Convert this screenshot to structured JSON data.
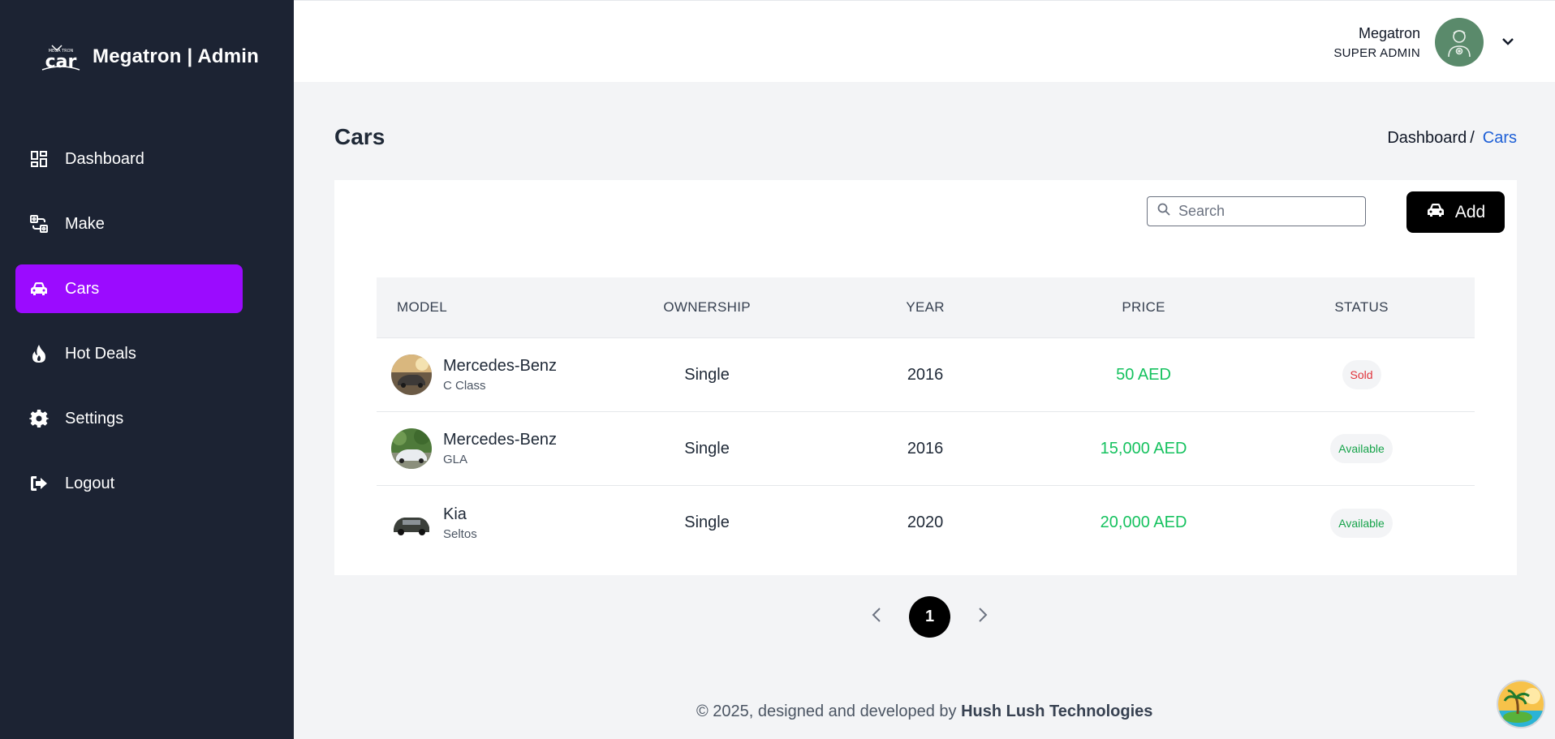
{
  "brand": {
    "name": "Megatron | Admin",
    "logo_text": "car",
    "logo_small": "MEGA TRON"
  },
  "sidebar": {
    "items": [
      {
        "label": "Dashboard",
        "icon": "dashboard-icon",
        "active": false
      },
      {
        "label": "Make",
        "icon": "make-icon",
        "active": false
      },
      {
        "label": "Cars",
        "icon": "car-icon",
        "active": true
      },
      {
        "label": "Hot Deals",
        "icon": "flame-icon",
        "active": false
      },
      {
        "label": "Settings",
        "icon": "gear-icon",
        "active": false
      },
      {
        "label": "Logout",
        "icon": "logout-icon",
        "active": false
      }
    ]
  },
  "header": {
    "user_name": "Megatron",
    "user_role": "SUPER ADMIN"
  },
  "page": {
    "title": "Cars",
    "breadcrumb_home": "Dashboard",
    "breadcrumb_sep": "/",
    "breadcrumb_current": "Cars"
  },
  "toolbar": {
    "search_placeholder": "Search",
    "search_value": "",
    "add_label": "Add"
  },
  "table": {
    "headers": {
      "model": "MODEL",
      "ownership": "OWNERSHIP",
      "year": "YEAR",
      "price": "PRICE",
      "status": "STATUS"
    },
    "rows": [
      {
        "make": "Mercedes-Benz",
        "variant": "C Class",
        "ownership": "Single",
        "year": "2016",
        "price": "50 AED",
        "status": "Sold"
      },
      {
        "make": "Mercedes-Benz",
        "variant": "GLA",
        "ownership": "Single",
        "year": "2016",
        "price": "15,000 AED",
        "status": "Available"
      },
      {
        "make": "Kia",
        "variant": "Seltos",
        "ownership": "Single",
        "year": "2020",
        "price": "20,000 AED",
        "status": "Available"
      }
    ]
  },
  "pagination": {
    "current": "1"
  },
  "footer": {
    "prefix": "© 2025, designed and developed by",
    "company": "Hush Lush Technologies"
  },
  "colors": {
    "sidebar_bg": "#1c2333",
    "active_nav": "#9b0bff",
    "price_green": "#16c25f",
    "sold_red": "#e0323a",
    "link_blue": "#1d5fd6"
  }
}
